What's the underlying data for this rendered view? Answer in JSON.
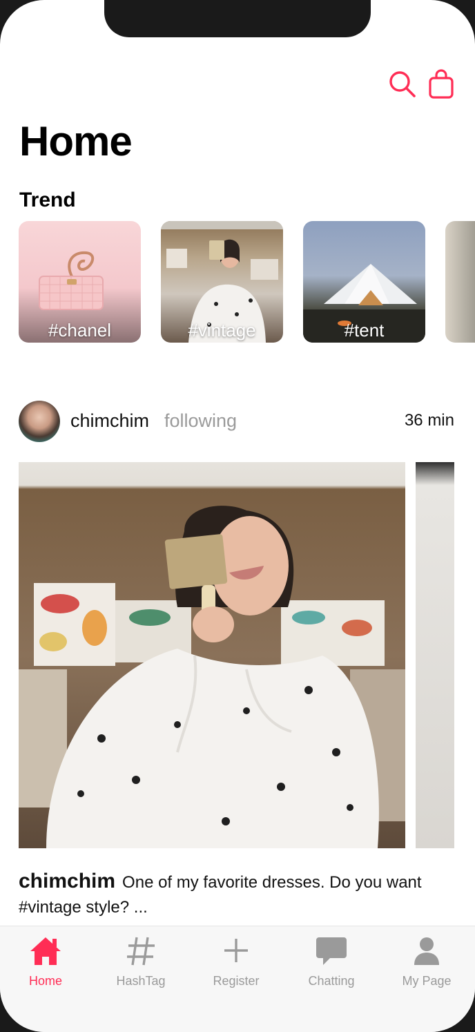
{
  "header": {
    "title": "Home",
    "search_icon": "search-icon",
    "bag_icon": "shopping-bag-icon"
  },
  "trend": {
    "label": "Trend",
    "items": [
      {
        "tag": "#chanel"
      },
      {
        "tag": "#vintage"
      },
      {
        "tag": "#tent"
      },
      {
        "tag": ""
      }
    ]
  },
  "post": {
    "username": "chimchim",
    "follow_status": "following",
    "time": "36 min",
    "caption_user": "chimchim",
    "caption_text": "One of my favorite dresses. Do you want #vintage style? ..."
  },
  "tabs": [
    {
      "label": "Home",
      "icon": "home-icon",
      "active": true
    },
    {
      "label": "HashTag",
      "icon": "hashtag-icon",
      "active": false
    },
    {
      "label": "Register",
      "icon": "plus-icon",
      "active": false
    },
    {
      "label": "Chatting",
      "icon": "chat-bubble-icon",
      "active": false
    },
    {
      "label": "My Page",
      "icon": "person-icon",
      "active": false
    }
  ],
  "colors": {
    "accent": "#ff2d55",
    "inactive": "#9a9a9a"
  }
}
